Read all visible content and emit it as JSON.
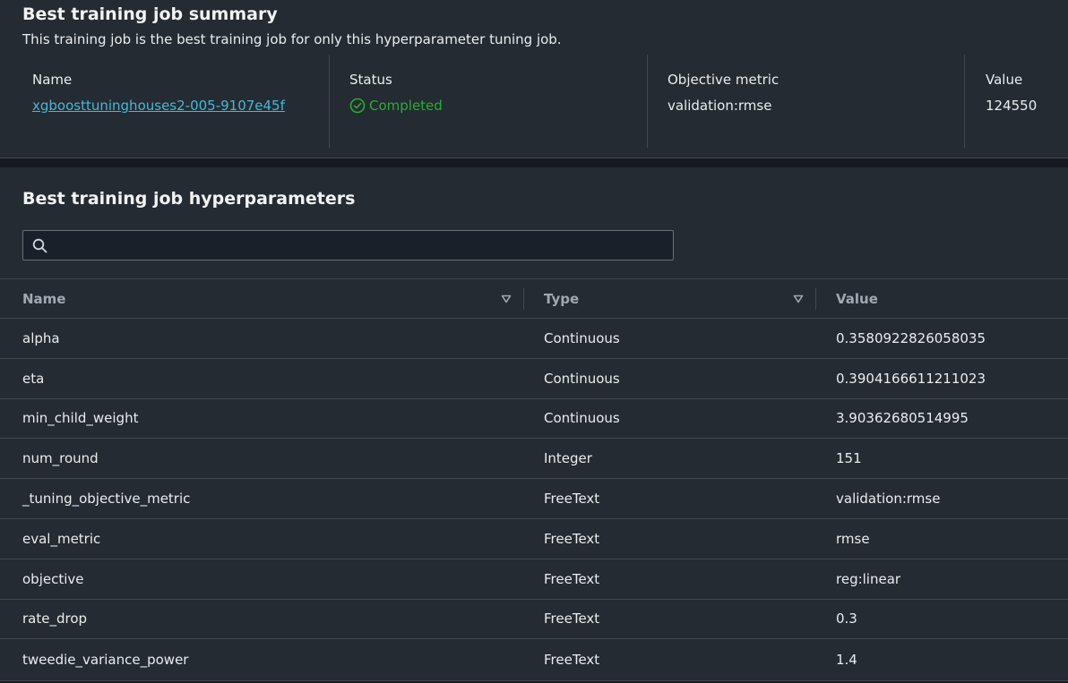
{
  "summary": {
    "title": "Best training job summary",
    "description": "This training job is the best training job for only this hyperparameter tuning job.",
    "name_label": "Name",
    "name_value": "xgboosttuninghouses2-005-9107e45f",
    "status_label": "Status",
    "status_value": "Completed",
    "metric_label": "Objective metric",
    "metric_value": "validation:rmse",
    "value_label": "Value",
    "value_value": "124550"
  },
  "hyperparameters": {
    "title": "Best training job hyperparameters",
    "search_placeholder": "",
    "columns": [
      "Name",
      "Type",
      "Value"
    ],
    "rows": [
      {
        "name": "alpha",
        "type": "Continuous",
        "value": "0.3580922826058035"
      },
      {
        "name": "eta",
        "type": "Continuous",
        "value": "0.3904166611211023"
      },
      {
        "name": "min_child_weight",
        "type": "Continuous",
        "value": "3.90362680514995"
      },
      {
        "name": "num_round",
        "type": "Integer",
        "value": "151"
      },
      {
        "name": "_tuning_objective_metric",
        "type": "FreeText",
        "value": "validation:rmse"
      },
      {
        "name": "eval_metric",
        "type": "FreeText",
        "value": "rmse"
      },
      {
        "name": "objective",
        "type": "FreeText",
        "value": "reg:linear"
      },
      {
        "name": "rate_drop",
        "type": "FreeText",
        "value": "0.3"
      },
      {
        "name": "tweedie_variance_power",
        "type": "FreeText",
        "value": "1.4"
      }
    ]
  },
  "colors": {
    "link": "#44b9d6",
    "success": "#29ad32",
    "panel": "#252b33"
  }
}
